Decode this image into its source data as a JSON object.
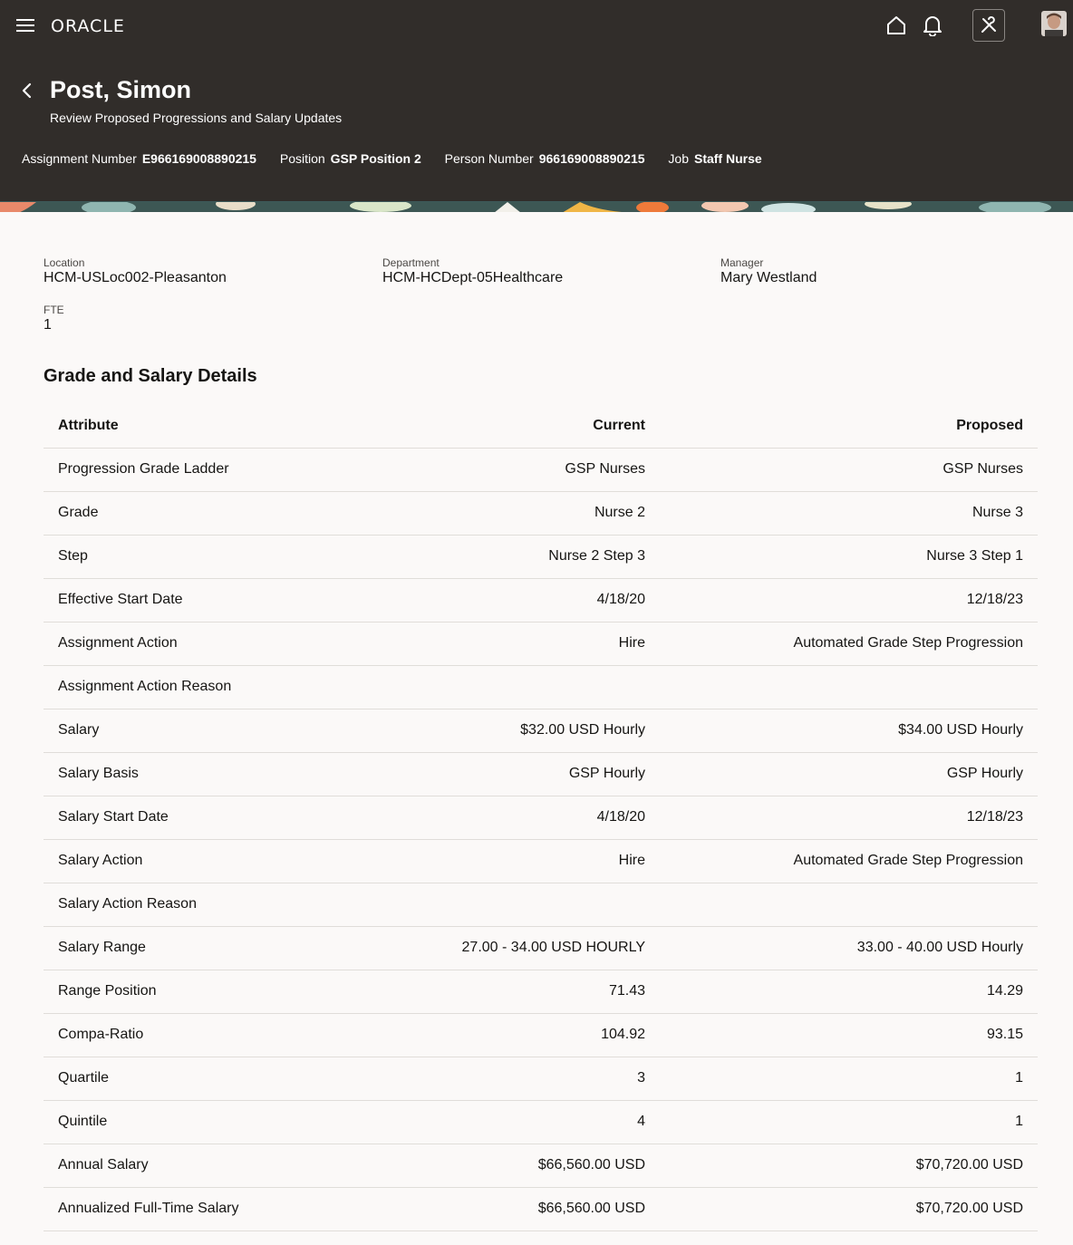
{
  "header": {
    "logo": "ORACLE",
    "title": "Post, Simon",
    "subtitle": "Review Proposed Progressions and Salary Updates",
    "meta": [
      {
        "label": "Assignment Number",
        "value": "E966169008890215"
      },
      {
        "label": "Position",
        "value": "GSP Position 2"
      },
      {
        "label": "Person Number",
        "value": "966169008890215"
      },
      {
        "label": "Job",
        "value": "Staff Nurse"
      }
    ],
    "icons": [
      "menu-icon",
      "home-icon",
      "bell-icon",
      "settings-icon",
      "avatar"
    ]
  },
  "details": {
    "location": {
      "label": "Location",
      "value": "HCM-USLoc002-Pleasanton"
    },
    "department": {
      "label": "Department",
      "value": "HCM-HCDept-05Healthcare"
    },
    "manager": {
      "label": "Manager",
      "value": "Mary Westland"
    },
    "fte": {
      "label": "FTE",
      "value": "1"
    }
  },
  "grade_section": {
    "title": "Grade and Salary Details",
    "columns": [
      "Attribute",
      "Current",
      "Proposed"
    ],
    "rows": [
      [
        "Progression Grade Ladder",
        "GSP Nurses",
        "GSP Nurses"
      ],
      [
        "Grade",
        "Nurse 2",
        "Nurse 3"
      ],
      [
        "Step",
        "Nurse 2 Step 3",
        "Nurse 3 Step 1"
      ],
      [
        "Effective Start Date",
        "4/18/20",
        "12/18/23"
      ],
      [
        "Assignment Action",
        "Hire",
        "Automated Grade Step Progression"
      ],
      [
        "Assignment Action Reason",
        "",
        ""
      ],
      [
        "Salary",
        "$32.00 USD Hourly",
        "$34.00 USD Hourly"
      ],
      [
        "Salary Basis",
        "GSP Hourly",
        "GSP Hourly"
      ],
      [
        "Salary Start Date",
        "4/18/20",
        "12/18/23"
      ],
      [
        "Salary Action",
        "Hire",
        "Automated Grade Step Progression"
      ],
      [
        "Salary Action Reason",
        "",
        ""
      ],
      [
        "Salary Range",
        "27.00 - 34.00 USD HOURLY",
        "33.00 - 40.00 USD Hourly"
      ],
      [
        "Range Position",
        "71.43",
        "14.29"
      ],
      [
        "Compa-Ratio",
        "104.92",
        "93.15"
      ],
      [
        "Quartile",
        "3",
        "1"
      ],
      [
        "Quintile",
        "4",
        "1"
      ],
      [
        "Annual Salary",
        "$66,560.00 USD",
        "$70,720.00 USD"
      ],
      [
        "Annualized Full-Time Salary",
        "$66,560.00 USD",
        "$70,720.00 USD"
      ]
    ]
  },
  "colors": {
    "header_bg": "#312d2a",
    "page_bg": "#fbf9f8",
    "divider": "#e0ddd9"
  }
}
